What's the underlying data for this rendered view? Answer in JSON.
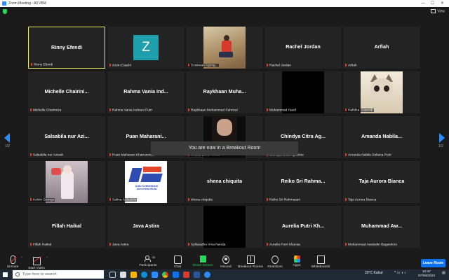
{
  "window": {
    "title": "Zoom Meeting - All VBM"
  },
  "header": {
    "view_label": "View"
  },
  "pager": {
    "left": "1/2",
    "right": "1/2"
  },
  "tiles": [
    {
      "title": "Rinny Efendi",
      "caption": "Rinny Efendi"
    },
    {
      "title": "Z",
      "caption": "zoom Eaa04"
    },
    {
      "title": "",
      "caption": "Dzakwan Agung..."
    },
    {
      "title": "Rachel Jordan",
      "caption": "Rachel Jordan"
    },
    {
      "title": "Arfiah",
      "caption": "Arfiah"
    },
    {
      "title": "Michelle Chairini...",
      "caption": "Michelle Chairiniza"
    },
    {
      "title": "Rahma Vania Ind...",
      "caption": "Rahma Vania Indriani Putri"
    },
    {
      "title": "Raykhaan Muha...",
      "caption": "Raykhaan Muhammad Fahrizal"
    },
    {
      "title": "",
      "caption": "Muhammad Hanif"
    },
    {
      "title": "",
      "caption": "Hafidza Lisasrah"
    },
    {
      "title": "Salsabila nur Azi...",
      "caption": "Salsabila nur Azizah"
    },
    {
      "title": "Puan Maharani...",
      "caption": "Puan Maharani Khairunnisa"
    },
    {
      "title": "",
      "caption": "Khalila Dewi Almira"
    },
    {
      "title": "Chindya Citra Ag...",
      "caption": "Chindya Citra Agustine"
    },
    {
      "title": "Amanda Nabila...",
      "caption": "Amanda Nabila Deliana Putri"
    },
    {
      "title": "",
      "caption": "Kelvin George"
    },
    {
      "title": "",
      "caption": "Salma Salsabila"
    },
    {
      "title": "shena chiquita",
      "caption": "shena chiquita"
    },
    {
      "title": "Reiko Sri Rahma...",
      "caption": "Reiko Sri Rahmasari"
    },
    {
      "title": "Taja Aurora Bianca",
      "caption": "Taja Aurora Bianca"
    },
    {
      "title": "Fillah Haikal",
      "caption": "Fillah Haikal"
    },
    {
      "title": "Java Astira",
      "caption": "Java Astira"
    },
    {
      "title": "",
      "caption": "Syifaradha Irma Nanda"
    },
    {
      "title": "Aurelia Putri Kh...",
      "caption": "Aurelia Putri Khansa"
    },
    {
      "title": "Muhammad Aw...",
      "caption": "Muhammad Awaludin Bagaskoro"
    }
  ],
  "logo_text": "ILMU KOMUNIKASI Universitas Mulia",
  "toast": "You are now in a Breakout Room",
  "toolbar": {
    "unmute": "Unmute",
    "start_video": "Start Video",
    "participants": "Participants",
    "participants_count": "35",
    "chat": "Chat",
    "share": "Share Screen",
    "record": "Record",
    "breakout": "Breakout Rooms",
    "reactions": "Reactions",
    "apps": "Apps",
    "whiteboards": "Whiteboards",
    "leave": "Leave Room"
  },
  "taskbar": {
    "search_placeholder": "Type here to search",
    "weather": "29°C Kabut",
    "time": "10:47",
    "date": "07/06/2022"
  }
}
